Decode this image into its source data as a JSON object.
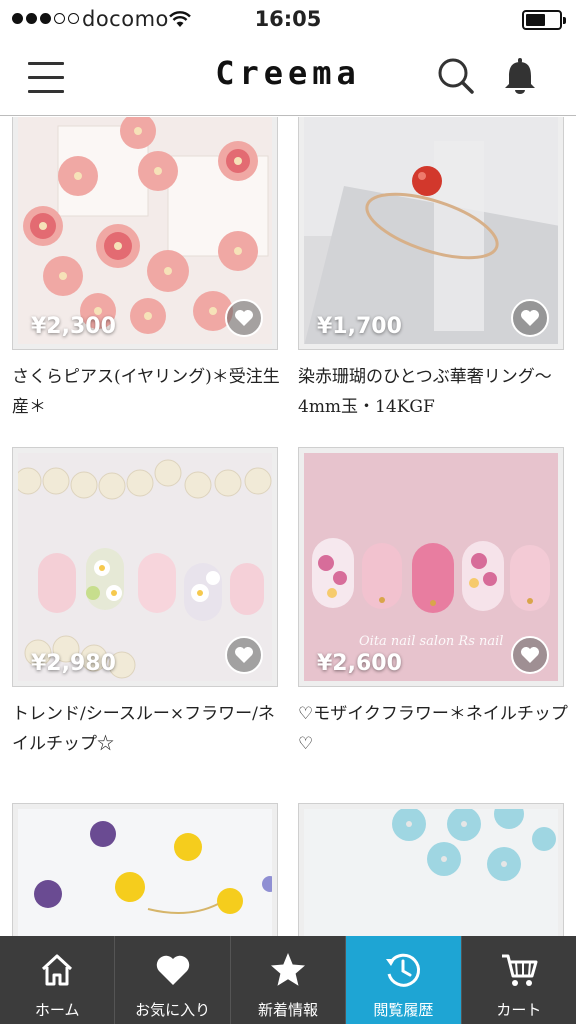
{
  "status_bar": {
    "carrier": "docomo",
    "time": "16:05",
    "signal_bars_filled": 3,
    "signal_bars_total": 5,
    "battery_level": 0.6
  },
  "header": {
    "logo": "Creema",
    "menu_icon": "hamburger-menu-icon",
    "search_icon": "search-icon",
    "notification_icon": "bell-icon"
  },
  "products": [
    {
      "price": "¥2,300",
      "title": "さくらピアス(イヤリング)＊受注生産＊",
      "image": "pink flower earrings"
    },
    {
      "price": "¥1,700",
      "title": "染赤珊瑚のひとつぶ華奢リング〜4mm玉・14KGF",
      "image": "coral bead ring"
    },
    {
      "price": "¥2,980",
      "title": "トレンド/シースルー×フラワー/ネイルチップ☆",
      "image": "pastel flower nail tips with pearls"
    },
    {
      "price": "¥2,600",
      "title": "♡モザイクフラワー＊ネイルチップ♡",
      "image": "pink mosaic flower nail tips",
      "watermark": "Oita nail salon Rs nail"
    },
    {
      "price": "",
      "title": "",
      "image": "pressed pansy flowers"
    },
    {
      "price": "",
      "title": "",
      "image": "blue resin flower beads"
    }
  ],
  "tabs": [
    {
      "label": "ホーム",
      "icon": "home-icon",
      "active": false
    },
    {
      "label": "お気に入り",
      "icon": "heart-icon",
      "active": false
    },
    {
      "label": "新着情報",
      "icon": "star-icon",
      "active": false
    },
    {
      "label": "閲覧履歴",
      "icon": "history-icon",
      "active": true
    },
    {
      "label": "カート",
      "icon": "cart-icon",
      "active": false
    }
  ],
  "colors": {
    "tabbar_bg": "#3c3c3c",
    "tab_active": "#1ea5d4",
    "header_border": "#bcbcbc"
  }
}
